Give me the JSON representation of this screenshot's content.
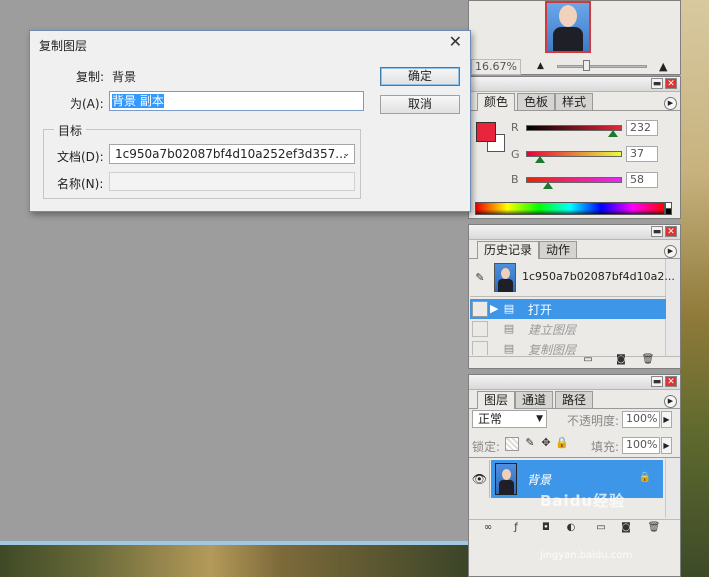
{
  "dialog": {
    "title": "复制图层",
    "copy_label": "复制:",
    "copy_value": "背景",
    "as_label": "为(A):",
    "as_value": "背景 副本",
    "ok_label": "确定",
    "cancel_label": "取消",
    "target_group": "目标",
    "doc_label": "文档(D):",
    "doc_value": "1c950a7b02087bf4d10a252ef3d357...",
    "name_label": "名称(N):",
    "name_value": ""
  },
  "navigator": {
    "zoom": "16.67%"
  },
  "color_panel": {
    "tabs": [
      "颜色",
      "色板",
      "样式"
    ],
    "active_tab": "颜色",
    "r_label": "R",
    "g_label": "G",
    "b_label": "B",
    "r_value": "232",
    "g_value": "37",
    "b_value": "58",
    "foreground_color": "#e8253a",
    "background_color": "#ffffff"
  },
  "history_panel": {
    "tabs": [
      "历史记录",
      "动作"
    ],
    "active_tab": "历史记录",
    "snapshot_label": "1c950a7b02087bf4d10a2...",
    "items": [
      {
        "label": "打开",
        "state": "selected"
      },
      {
        "label": "建立图层",
        "state": "undone"
      },
      {
        "label": "复制图层",
        "state": "undone"
      }
    ]
  },
  "layers_panel": {
    "tabs": [
      "图层",
      "通道",
      "路径"
    ],
    "active_tab": "图层",
    "blend_mode": "正常",
    "opacity_label": "不透明度:",
    "opacity_value": "100%",
    "lock_label": "锁定:",
    "fill_label": "填充:",
    "fill_value": "100%",
    "layers": [
      {
        "name": "背景",
        "locked": true,
        "visible": true,
        "selected": true
      }
    ]
  },
  "watermark": {
    "text": "Baidu经验",
    "url": "jingyan.baidu.com"
  }
}
